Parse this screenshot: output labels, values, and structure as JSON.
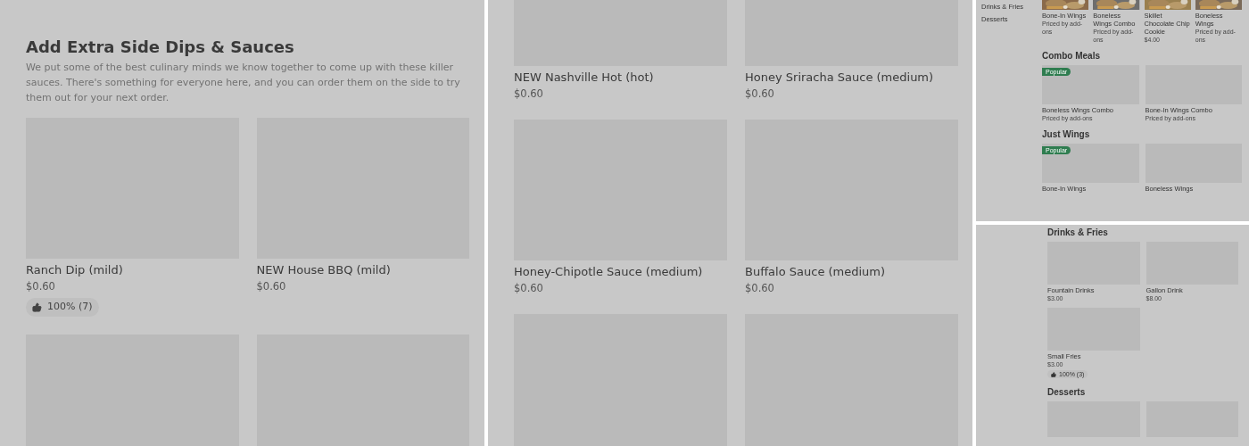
{
  "panel_1": {
    "title": "Add Extra Side Dips & Sauces",
    "description": "We put some of the best culinary minds we know together to come up with these killer sauces. There's something for everyone here, and you can order them on the side to try them out for your next order.",
    "items": [
      {
        "name": "Ranch Dip (mild)",
        "price": "$0.60",
        "rating": "100% (7)"
      },
      {
        "name": "NEW House BBQ (mild)",
        "price": "$0.60"
      }
    ]
  },
  "panel_2": {
    "items": [
      {
        "name": "NEW Nashville Hot (hot)",
        "price": "$0.60"
      },
      {
        "name": "Honey Sriracha Sauce (medium)",
        "price": "$0.60"
      },
      {
        "name": "Honey-Chipotle Sauce (medium)",
        "price": "$0.60"
      },
      {
        "name": "Buffalo Sauce (medium)",
        "price": "$0.60"
      }
    ]
  },
  "panel_3_top": {
    "sidebar": [
      {
        "label": "Drinks & Fries"
      },
      {
        "label": "Desserts"
      }
    ],
    "featured": [
      {
        "name": "Bone-In Wings",
        "price": "Priced by add-ons"
      },
      {
        "name": "Boneless Wings Combo",
        "price": "Priced by add-ons"
      },
      {
        "name": "Skillet Chocolate Chip Cookie",
        "price": "$4.00"
      },
      {
        "name": "Boneless Wings",
        "price": "Priced by add-ons"
      }
    ],
    "sections": [
      {
        "title": "Combo Meals",
        "items": [
          {
            "name": "Boneless Wings Combo",
            "price": "Priced by add-ons",
            "badge": "Popular"
          },
          {
            "name": "Bone-In Wings Combo",
            "price": "Priced by add-ons"
          }
        ]
      },
      {
        "title": "Just Wings",
        "items": [
          {
            "name": "Bone-In Wings",
            "badge": "Popular"
          },
          {
            "name": "Boneless Wings"
          }
        ]
      }
    ]
  },
  "panel_3_bottom": {
    "sections": [
      {
        "title": "Drinks & Fries",
        "items": [
          {
            "name": "Fountain Drinks",
            "price": "$3.00"
          },
          {
            "name": "Gallon Drink",
            "price": "$8.00"
          },
          {
            "name": "Small Fries",
            "price": "$3.00",
            "rating": "100% (3)"
          }
        ]
      },
      {
        "title": "Desserts"
      }
    ]
  }
}
